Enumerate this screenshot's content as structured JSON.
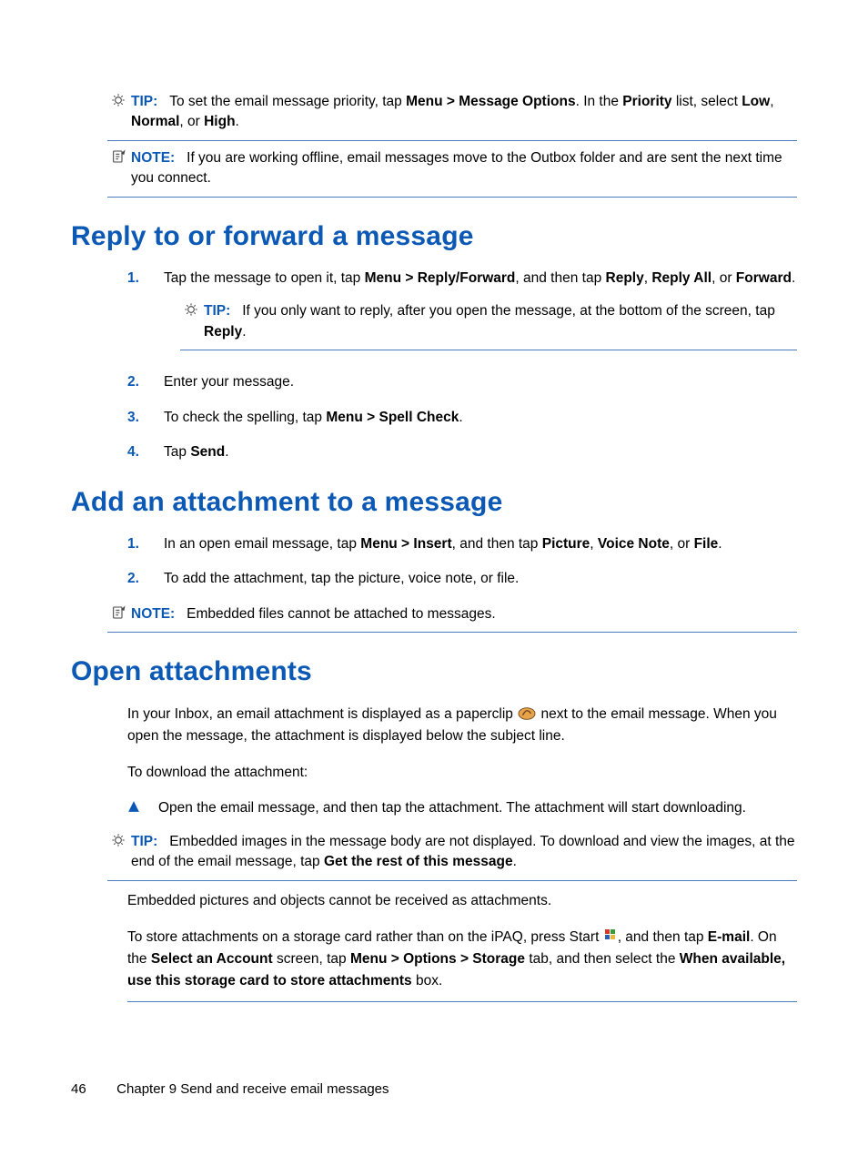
{
  "labels": {
    "tip": "TIP:",
    "note": "NOTE:"
  },
  "tip1": {
    "pre": "To set the email message priority, tap ",
    "b1": "Menu > Message Options",
    "mid": ". In the ",
    "b2": "Priority",
    "post1": " list, select ",
    "b3": "Low",
    "comma1": ", ",
    "b4": "Normal",
    "comma2": ", or ",
    "b5": "High",
    "end": "."
  },
  "note1": {
    "text": "If you are working offline, email messages move to the Outbox folder and are sent the next time you connect."
  },
  "sec1": {
    "title": "Reply to or forward a message",
    "step1": {
      "a": "Tap the message to open it, tap ",
      "b1": "Menu > Reply/Forward",
      "b": ", and then tap ",
      "b2": "Reply",
      "c": ", ",
      "b3": "Reply All",
      "d": ", or ",
      "b4": "Forward",
      "e": "."
    },
    "tip": {
      "a": "If you only want to reply, after you open the message, at the bottom of the screen, tap ",
      "b1": "Reply",
      "b": "."
    },
    "step2": "Enter your message.",
    "step3": {
      "a": "To check the spelling, tap ",
      "b1": "Menu > Spell Check",
      "b": "."
    },
    "step4": {
      "a": "Tap ",
      "b1": "Send",
      "b": "."
    }
  },
  "sec2": {
    "title": "Add an attachment to a message",
    "step1": {
      "a": "In an open email message, tap ",
      "b1": "Menu > Insert",
      "b": ", and then tap ",
      "b2": "Picture",
      "c": ", ",
      "b3": "Voice Note",
      "d": ", or ",
      "b4": "File",
      "e": "."
    },
    "step2": "To add the attachment, tap the picture, voice note, or file.",
    "note": "Embedded files cannot be attached to messages."
  },
  "sec3": {
    "title": "Open attachments",
    "p1a": "In your Inbox, an email attachment is displayed as a paperclip ",
    "p1b": " next to the email message. When you open the message, the attachment is displayed below the subject line.",
    "p2": "To download the attachment:",
    "bullet1": "Open the email message, and then tap the attachment. The attachment will start downloading.",
    "tip": {
      "a": "Embedded images in the message body are not displayed. To download and view the images, at the end of the email message, tap ",
      "b1": "Get the rest of this message",
      "b": "."
    },
    "p3": "Embedded pictures and objects cannot be received as attachments.",
    "p4": {
      "a": "To store attachments on a storage card rather than on the iPAQ, press Start ",
      "b": ", and then tap ",
      "b1": "E-mail",
      "c": ". On the ",
      "b2": "Select an Account",
      "d": " screen, tap ",
      "b3": "Menu > Options > Storage",
      "e": " tab, and then select the ",
      "b4": "When available, use this storage card to store attachments",
      "f": " box."
    }
  },
  "footer": {
    "page": "46",
    "chapter": "Chapter 9   Send and receive email messages"
  }
}
